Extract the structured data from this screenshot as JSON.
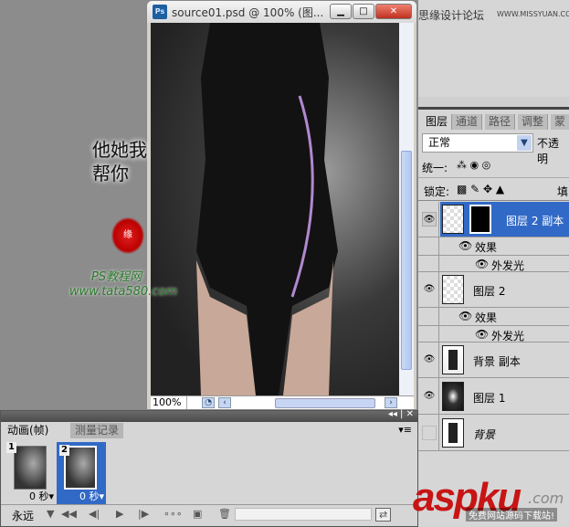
{
  "document": {
    "title": "source01.psd @ 100% (图...",
    "zoom": "100%",
    "app_icon": "Ps"
  },
  "watermarks": {
    "site_cn": "思缘设计论坛",
    "site_url": "WWW.MISSYUAN.COM",
    "logo_chars": "他她我帮你",
    "seal": "缘",
    "ps_site": "PS教程网",
    "ps_url": "www.tata580.com",
    "aspku": "aspku",
    "aspku_com": ".com",
    "aspku_sub": "免费网站源码下载站!"
  },
  "layers_panel": {
    "tabs": [
      "图层",
      "通道",
      "路径",
      "调整",
      "蒙"
    ],
    "blend_mode": "正常",
    "opacity_label": "不透明",
    "unify_label": "统一:",
    "lock_label": "锁定:",
    "fill_label": "填",
    "layers": [
      {
        "name": "图层 2 副本",
        "visible": true,
        "selected": true
      },
      {
        "name": "图层 2",
        "visible": true
      },
      {
        "name": "背景 副本",
        "visible": true
      },
      {
        "name": "图层 1",
        "visible": true
      },
      {
        "name": "背景",
        "visible": false
      }
    ],
    "effects_label": "效果",
    "outer_glow_label": "外发光"
  },
  "animation_panel": {
    "tabs": [
      "动画(帧)",
      "测量记录"
    ],
    "frames": [
      {
        "num": "1",
        "time": "0 秒▾"
      },
      {
        "num": "2",
        "time": "0 秒▾",
        "selected": true
      }
    ],
    "loop": "永远"
  }
}
